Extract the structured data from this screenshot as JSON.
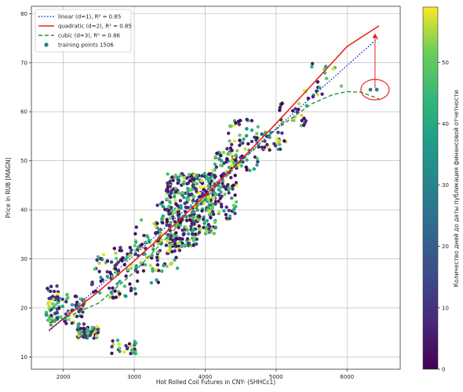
{
  "chart_data": {
    "type": "scatter",
    "title": "",
    "xlabel": "Hot Rolled Coil Futures in CNY- (SHHCc1)",
    "ylabel": "Price in RUB [MAGN]",
    "xlim": [
      1550,
      6750
    ],
    "ylim": [
      7.5,
      81.5
    ],
    "xticks": [
      2000,
      3000,
      4000,
      5000,
      6000
    ],
    "yticks": [
      10,
      20,
      30,
      40,
      50,
      60,
      70,
      80
    ],
    "grid": true,
    "legend_location": "upper-left",
    "legend": [
      {
        "key": "linear",
        "text": "linear (d=1), R² = 0.85",
        "color": "#1f1fd0",
        "style": "dotted"
      },
      {
        "key": "quadratic",
        "text": "quadratic (d=2), R² = 0.85",
        "color": "#e8241c",
        "style": "solid"
      },
      {
        "key": "cubic",
        "text": "cubic (d=3), R² = 0.86",
        "color": "#2f8f2f",
        "style": "dashed"
      },
      {
        "key": "points",
        "text": "training points 1506",
        "color": "#2a788e",
        "style": "marker"
      }
    ],
    "fits": {
      "linear": {
        "x": [
          1800,
          6450
        ],
        "y": [
          15.3,
          75.2
        ]
      },
      "quadratic": {
        "x": [
          1800,
          2500,
          3000,
          3500,
          4000,
          4500,
          5000,
          5500,
          6000,
          6450
        ],
        "y": [
          15.5,
          23.4,
          29.6,
          36.1,
          42.9,
          50.1,
          57.6,
          65.4,
          73.3,
          77.5
        ]
      },
      "cubic": {
        "x": [
          1800,
          2000,
          2500,
          3000,
          3500,
          4000,
          4500,
          5000,
          5500,
          5800,
          6000,
          6200,
          6450
        ],
        "y": [
          17.0,
          17.8,
          21.0,
          27.3,
          35.0,
          42.3,
          49.8,
          56.4,
          61.6,
          63.5,
          64.1,
          64.0,
          62.6
        ]
      }
    },
    "colorbar": {
      "label": "Количество дней до даты публикация финансовой отчетности",
      "range": [
        0,
        59
      ],
      "ticks": [
        0,
        10,
        20,
        30,
        40,
        50
      ],
      "colormap": "viridis"
    },
    "point_clusters": [
      {
        "x": [
          1760,
          1950
        ],
        "y": [
          16.5,
          24.5
        ],
        "n": 60
      },
      {
        "x": [
          1950,
          2300
        ],
        "y": [
          16.5,
          23.0
        ],
        "n": 45
      },
      {
        "x": [
          2200,
          2500
        ],
        "y": [
          13.8,
          16.2
        ],
        "n": 55
      },
      {
        "x": [
          2400,
          2750
        ],
        "y": [
          22.0,
          31.0
        ],
        "n": 40
      },
      {
        "x": [
          2650,
          3050
        ],
        "y": [
          10.5,
          13.5
        ],
        "n": 25
      },
      {
        "x": [
          2700,
          3050
        ],
        "y": [
          22.0,
          33.5
        ],
        "n": 45
      },
      {
        "x": [
          3000,
          3400
        ],
        "y": [
          25.0,
          38.0
        ],
        "n": 60
      },
      {
        "x": [
          3300,
          3650
        ],
        "y": [
          28.0,
          42.0
        ],
        "n": 80
      },
      {
        "x": [
          3450,
          3900
        ],
        "y": [
          32.5,
          47.5
        ],
        "n": 220
      },
      {
        "x": [
          3800,
          4150
        ],
        "y": [
          35.0,
          47.5
        ],
        "n": 170
      },
      {
        "x": [
          4100,
          4450
        ],
        "y": [
          38.0,
          52.0
        ],
        "n": 110
      },
      {
        "x": [
          4300,
          4750
        ],
        "y": [
          48.0,
          58.5
        ],
        "n": 55
      },
      {
        "x": [
          4650,
          5150
        ],
        "y": [
          52.0,
          56.0
        ],
        "n": 35
      },
      {
        "x": [
          5050,
          5450
        ],
        "y": [
          57.0,
          62.0
        ],
        "n": 25
      },
      {
        "x": [
          5350,
          5650
        ],
        "y": [
          62.0,
          70.0
        ],
        "n": 12
      },
      {
        "x": [
          5600,
          5950
        ],
        "y": [
          64.0,
          69.5
        ],
        "n": 8
      }
    ],
    "annotations": {
      "highlight_points": {
        "x": [
          6330,
          6420
        ],
        "y": [
          64.5,
          64.5
        ]
      },
      "ellipse": {
        "cx": 6395,
        "cy": 64.5,
        "label": ""
      },
      "arrow": {
        "from": [
          6395,
          64.8
        ],
        "to": [
          6395,
          76.0
        ],
        "color": "#e8241c"
      }
    }
  }
}
